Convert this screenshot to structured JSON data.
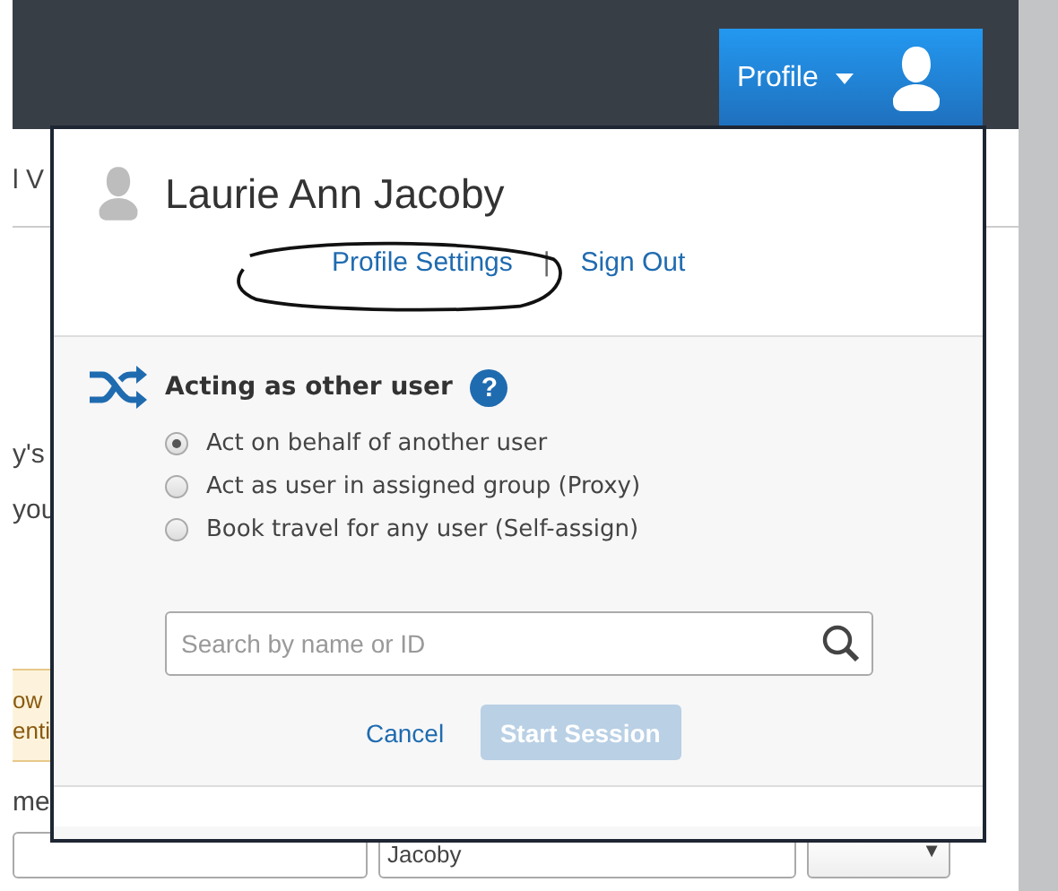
{
  "header": {
    "profile_button": {
      "label": "Profile",
      "expanded": true
    }
  },
  "background": {
    "fragments": [
      "l V",
      "y's",
      "you"
    ],
    "notice_lines": [
      "ow",
      "enti"
    ],
    "label": "me",
    "fields": [
      {
        "kind": "text"
      },
      {
        "kind": "text",
        "value": "Jacoby"
      },
      {
        "kind": "select",
        "value": "▼"
      }
    ]
  },
  "profile_menu": {
    "user_name": "Laurie Ann Jacoby",
    "links": [
      "Profile Settings",
      "Sign Out"
    ],
    "separator": "|",
    "annotation_circled": true,
    "acting": {
      "title": "Acting as other user",
      "help": "?",
      "options": [
        {
          "label": "Act on behalf of another user",
          "selected": true
        },
        {
          "label": "Act as user in assigned group (Proxy)",
          "selected": false
        },
        {
          "label": "Book travel for any user (Self-assign)",
          "selected": false
        }
      ],
      "search": {
        "placeholder": "Search by name or ID"
      },
      "buttons": [
        {
          "label": "Cancel",
          "kind": "link"
        },
        {
          "label": "Start Session",
          "kind": "primary",
          "disabled": true
        }
      ]
    }
  }
}
